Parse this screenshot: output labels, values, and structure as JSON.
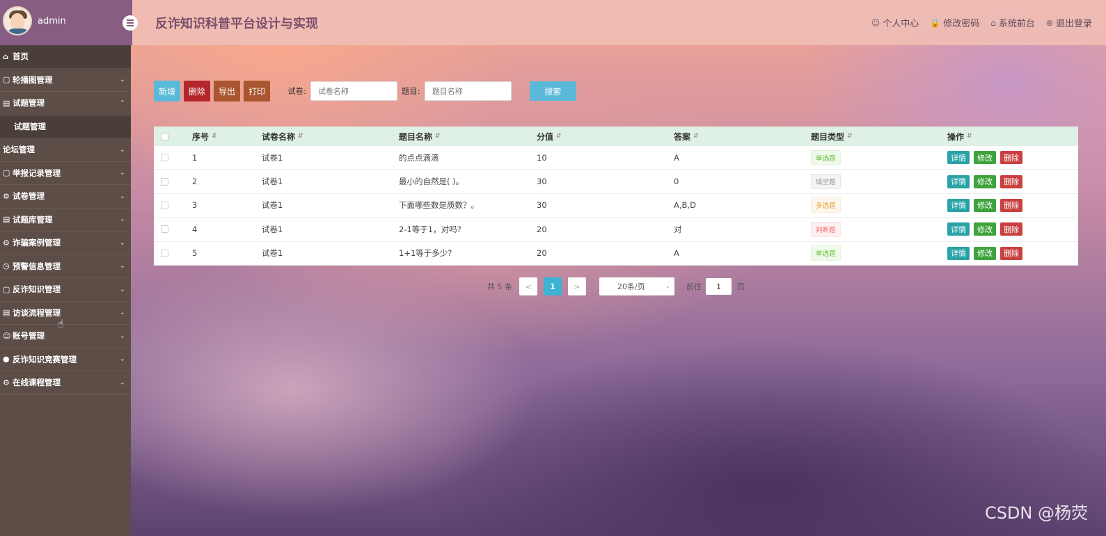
{
  "header": {
    "username": "admin",
    "site_title": "反诈知识科普平台设计与实现",
    "links": [
      {
        "icon": "user-icon",
        "label": "个人中心"
      },
      {
        "icon": "lock-icon",
        "label": "修改密码"
      },
      {
        "icon": "home-icon",
        "label": "系统前台"
      },
      {
        "icon": "close-circle-icon",
        "label": "退出登录"
      }
    ]
  },
  "sidebar": {
    "home": "首页",
    "items": [
      {
        "label": "轮播图管理",
        "icon": "image-icon"
      },
      {
        "label": "试题管理",
        "icon": "doc-icon",
        "expanded": true,
        "children": [
          "试题管理"
        ]
      },
      {
        "label": "论坛管理",
        "icon": "none"
      },
      {
        "label": "举报记录管理",
        "icon": "image-icon"
      },
      {
        "label": "试卷管理",
        "icon": "gear-icon"
      },
      {
        "label": "试题库管理",
        "icon": "doc-icon"
      },
      {
        "label": "诈骗案例管理",
        "icon": "gear-icon"
      },
      {
        "label": "预警信息管理",
        "icon": "clock-icon"
      },
      {
        "label": "反诈知识管理",
        "icon": "image-icon"
      },
      {
        "label": "访谈流程管理",
        "icon": "doc-icon"
      },
      {
        "label": "账号管理",
        "icon": "user-icon"
      },
      {
        "label": "反诈知识竞赛管理",
        "icon": "circle-icon"
      },
      {
        "label": "在线课程管理",
        "icon": "gear-icon"
      }
    ]
  },
  "toolbar": {
    "add_label": "新增",
    "delete_label": "删除",
    "export_label": "导出",
    "print_label": "打印",
    "paper_label": "试卷:",
    "paper_placeholder": "试卷名称",
    "question_label": "题目:",
    "question_placeholder": "题目名称",
    "search_label": "搜索"
  },
  "table": {
    "columns": [
      "序号",
      "试卷名称",
      "题目名称",
      "分值",
      "答案",
      "题目类型",
      "操作"
    ],
    "rows": [
      {
        "idx": "1",
        "paper": "试卷1",
        "title": "的点点滴滴",
        "score": "10",
        "answer": "A",
        "type": "单选题",
        "type_kind": "single"
      },
      {
        "idx": "2",
        "paper": "试卷1",
        "title": "最小的自然是( )。",
        "score": "30",
        "answer": "0",
        "type": "填空题",
        "type_kind": "fill"
      },
      {
        "idx": "3",
        "paper": "试卷1",
        "title": "下面哪些数是质数？。",
        "score": "30",
        "answer": "A,B,D",
        "type": "多选题",
        "type_kind": "multi"
      },
      {
        "idx": "4",
        "paper": "试卷1",
        "title": "2-1等于1，对吗?",
        "score": "20",
        "answer": "对",
        "type": "判断题",
        "type_kind": "judge"
      },
      {
        "idx": "5",
        "paper": "试卷1",
        "title": "1+1等于多少?",
        "score": "20",
        "answer": "A",
        "type": "单选题",
        "type_kind": "single"
      }
    ],
    "ops": {
      "detail": "详情",
      "edit": "修改",
      "delete": "删除"
    }
  },
  "pagination": {
    "total": "共 5 条",
    "prev": "<",
    "current_page": "1",
    "next": ">",
    "page_size": "20条/页",
    "goto_label": "前往",
    "goto_value": "1",
    "page_suffix": "页"
  },
  "watermark": "CSDN @杨荧"
}
